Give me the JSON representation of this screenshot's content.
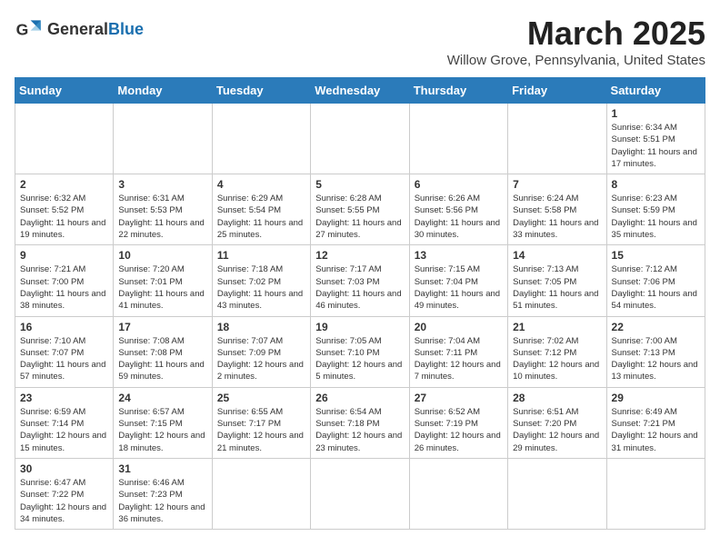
{
  "header": {
    "logo_text_normal": "General",
    "logo_text_blue": "Blue",
    "month_year": "March 2025",
    "location": "Willow Grove, Pennsylvania, United States"
  },
  "days_of_week": [
    "Sunday",
    "Monday",
    "Tuesday",
    "Wednesday",
    "Thursday",
    "Friday",
    "Saturday"
  ],
  "weeks": [
    [
      {
        "day": "",
        "text": ""
      },
      {
        "day": "",
        "text": ""
      },
      {
        "day": "",
        "text": ""
      },
      {
        "day": "",
        "text": ""
      },
      {
        "day": "",
        "text": ""
      },
      {
        "day": "",
        "text": ""
      },
      {
        "day": "1",
        "text": "Sunrise: 6:34 AM\nSunset: 5:51 PM\nDaylight: 11 hours and 17 minutes."
      }
    ],
    [
      {
        "day": "2",
        "text": "Sunrise: 6:32 AM\nSunset: 5:52 PM\nDaylight: 11 hours and 19 minutes."
      },
      {
        "day": "3",
        "text": "Sunrise: 6:31 AM\nSunset: 5:53 PM\nDaylight: 11 hours and 22 minutes."
      },
      {
        "day": "4",
        "text": "Sunrise: 6:29 AM\nSunset: 5:54 PM\nDaylight: 11 hours and 25 minutes."
      },
      {
        "day": "5",
        "text": "Sunrise: 6:28 AM\nSunset: 5:55 PM\nDaylight: 11 hours and 27 minutes."
      },
      {
        "day": "6",
        "text": "Sunrise: 6:26 AM\nSunset: 5:56 PM\nDaylight: 11 hours and 30 minutes."
      },
      {
        "day": "7",
        "text": "Sunrise: 6:24 AM\nSunset: 5:58 PM\nDaylight: 11 hours and 33 minutes."
      },
      {
        "day": "8",
        "text": "Sunrise: 6:23 AM\nSunset: 5:59 PM\nDaylight: 11 hours and 35 minutes."
      }
    ],
    [
      {
        "day": "9",
        "text": "Sunrise: 7:21 AM\nSunset: 7:00 PM\nDaylight: 11 hours and 38 minutes."
      },
      {
        "day": "10",
        "text": "Sunrise: 7:20 AM\nSunset: 7:01 PM\nDaylight: 11 hours and 41 minutes."
      },
      {
        "day": "11",
        "text": "Sunrise: 7:18 AM\nSunset: 7:02 PM\nDaylight: 11 hours and 43 minutes."
      },
      {
        "day": "12",
        "text": "Sunrise: 7:17 AM\nSunset: 7:03 PM\nDaylight: 11 hours and 46 minutes."
      },
      {
        "day": "13",
        "text": "Sunrise: 7:15 AM\nSunset: 7:04 PM\nDaylight: 11 hours and 49 minutes."
      },
      {
        "day": "14",
        "text": "Sunrise: 7:13 AM\nSunset: 7:05 PM\nDaylight: 11 hours and 51 minutes."
      },
      {
        "day": "15",
        "text": "Sunrise: 7:12 AM\nSunset: 7:06 PM\nDaylight: 11 hours and 54 minutes."
      }
    ],
    [
      {
        "day": "16",
        "text": "Sunrise: 7:10 AM\nSunset: 7:07 PM\nDaylight: 11 hours and 57 minutes."
      },
      {
        "day": "17",
        "text": "Sunrise: 7:08 AM\nSunset: 7:08 PM\nDaylight: 11 hours and 59 minutes."
      },
      {
        "day": "18",
        "text": "Sunrise: 7:07 AM\nSunset: 7:09 PM\nDaylight: 12 hours and 2 minutes."
      },
      {
        "day": "19",
        "text": "Sunrise: 7:05 AM\nSunset: 7:10 PM\nDaylight: 12 hours and 5 minutes."
      },
      {
        "day": "20",
        "text": "Sunrise: 7:04 AM\nSunset: 7:11 PM\nDaylight: 12 hours and 7 minutes."
      },
      {
        "day": "21",
        "text": "Sunrise: 7:02 AM\nSunset: 7:12 PM\nDaylight: 12 hours and 10 minutes."
      },
      {
        "day": "22",
        "text": "Sunrise: 7:00 AM\nSunset: 7:13 PM\nDaylight: 12 hours and 13 minutes."
      }
    ],
    [
      {
        "day": "23",
        "text": "Sunrise: 6:59 AM\nSunset: 7:14 PM\nDaylight: 12 hours and 15 minutes."
      },
      {
        "day": "24",
        "text": "Sunrise: 6:57 AM\nSunset: 7:15 PM\nDaylight: 12 hours and 18 minutes."
      },
      {
        "day": "25",
        "text": "Sunrise: 6:55 AM\nSunset: 7:17 PM\nDaylight: 12 hours and 21 minutes."
      },
      {
        "day": "26",
        "text": "Sunrise: 6:54 AM\nSunset: 7:18 PM\nDaylight: 12 hours and 23 minutes."
      },
      {
        "day": "27",
        "text": "Sunrise: 6:52 AM\nSunset: 7:19 PM\nDaylight: 12 hours and 26 minutes."
      },
      {
        "day": "28",
        "text": "Sunrise: 6:51 AM\nSunset: 7:20 PM\nDaylight: 12 hours and 29 minutes."
      },
      {
        "day": "29",
        "text": "Sunrise: 6:49 AM\nSunset: 7:21 PM\nDaylight: 12 hours and 31 minutes."
      }
    ],
    [
      {
        "day": "30",
        "text": "Sunrise: 6:47 AM\nSunset: 7:22 PM\nDaylight: 12 hours and 34 minutes."
      },
      {
        "day": "31",
        "text": "Sunrise: 6:46 AM\nSunset: 7:23 PM\nDaylight: 12 hours and 36 minutes."
      },
      {
        "day": "",
        "text": ""
      },
      {
        "day": "",
        "text": ""
      },
      {
        "day": "",
        "text": ""
      },
      {
        "day": "",
        "text": ""
      },
      {
        "day": "",
        "text": ""
      }
    ]
  ]
}
